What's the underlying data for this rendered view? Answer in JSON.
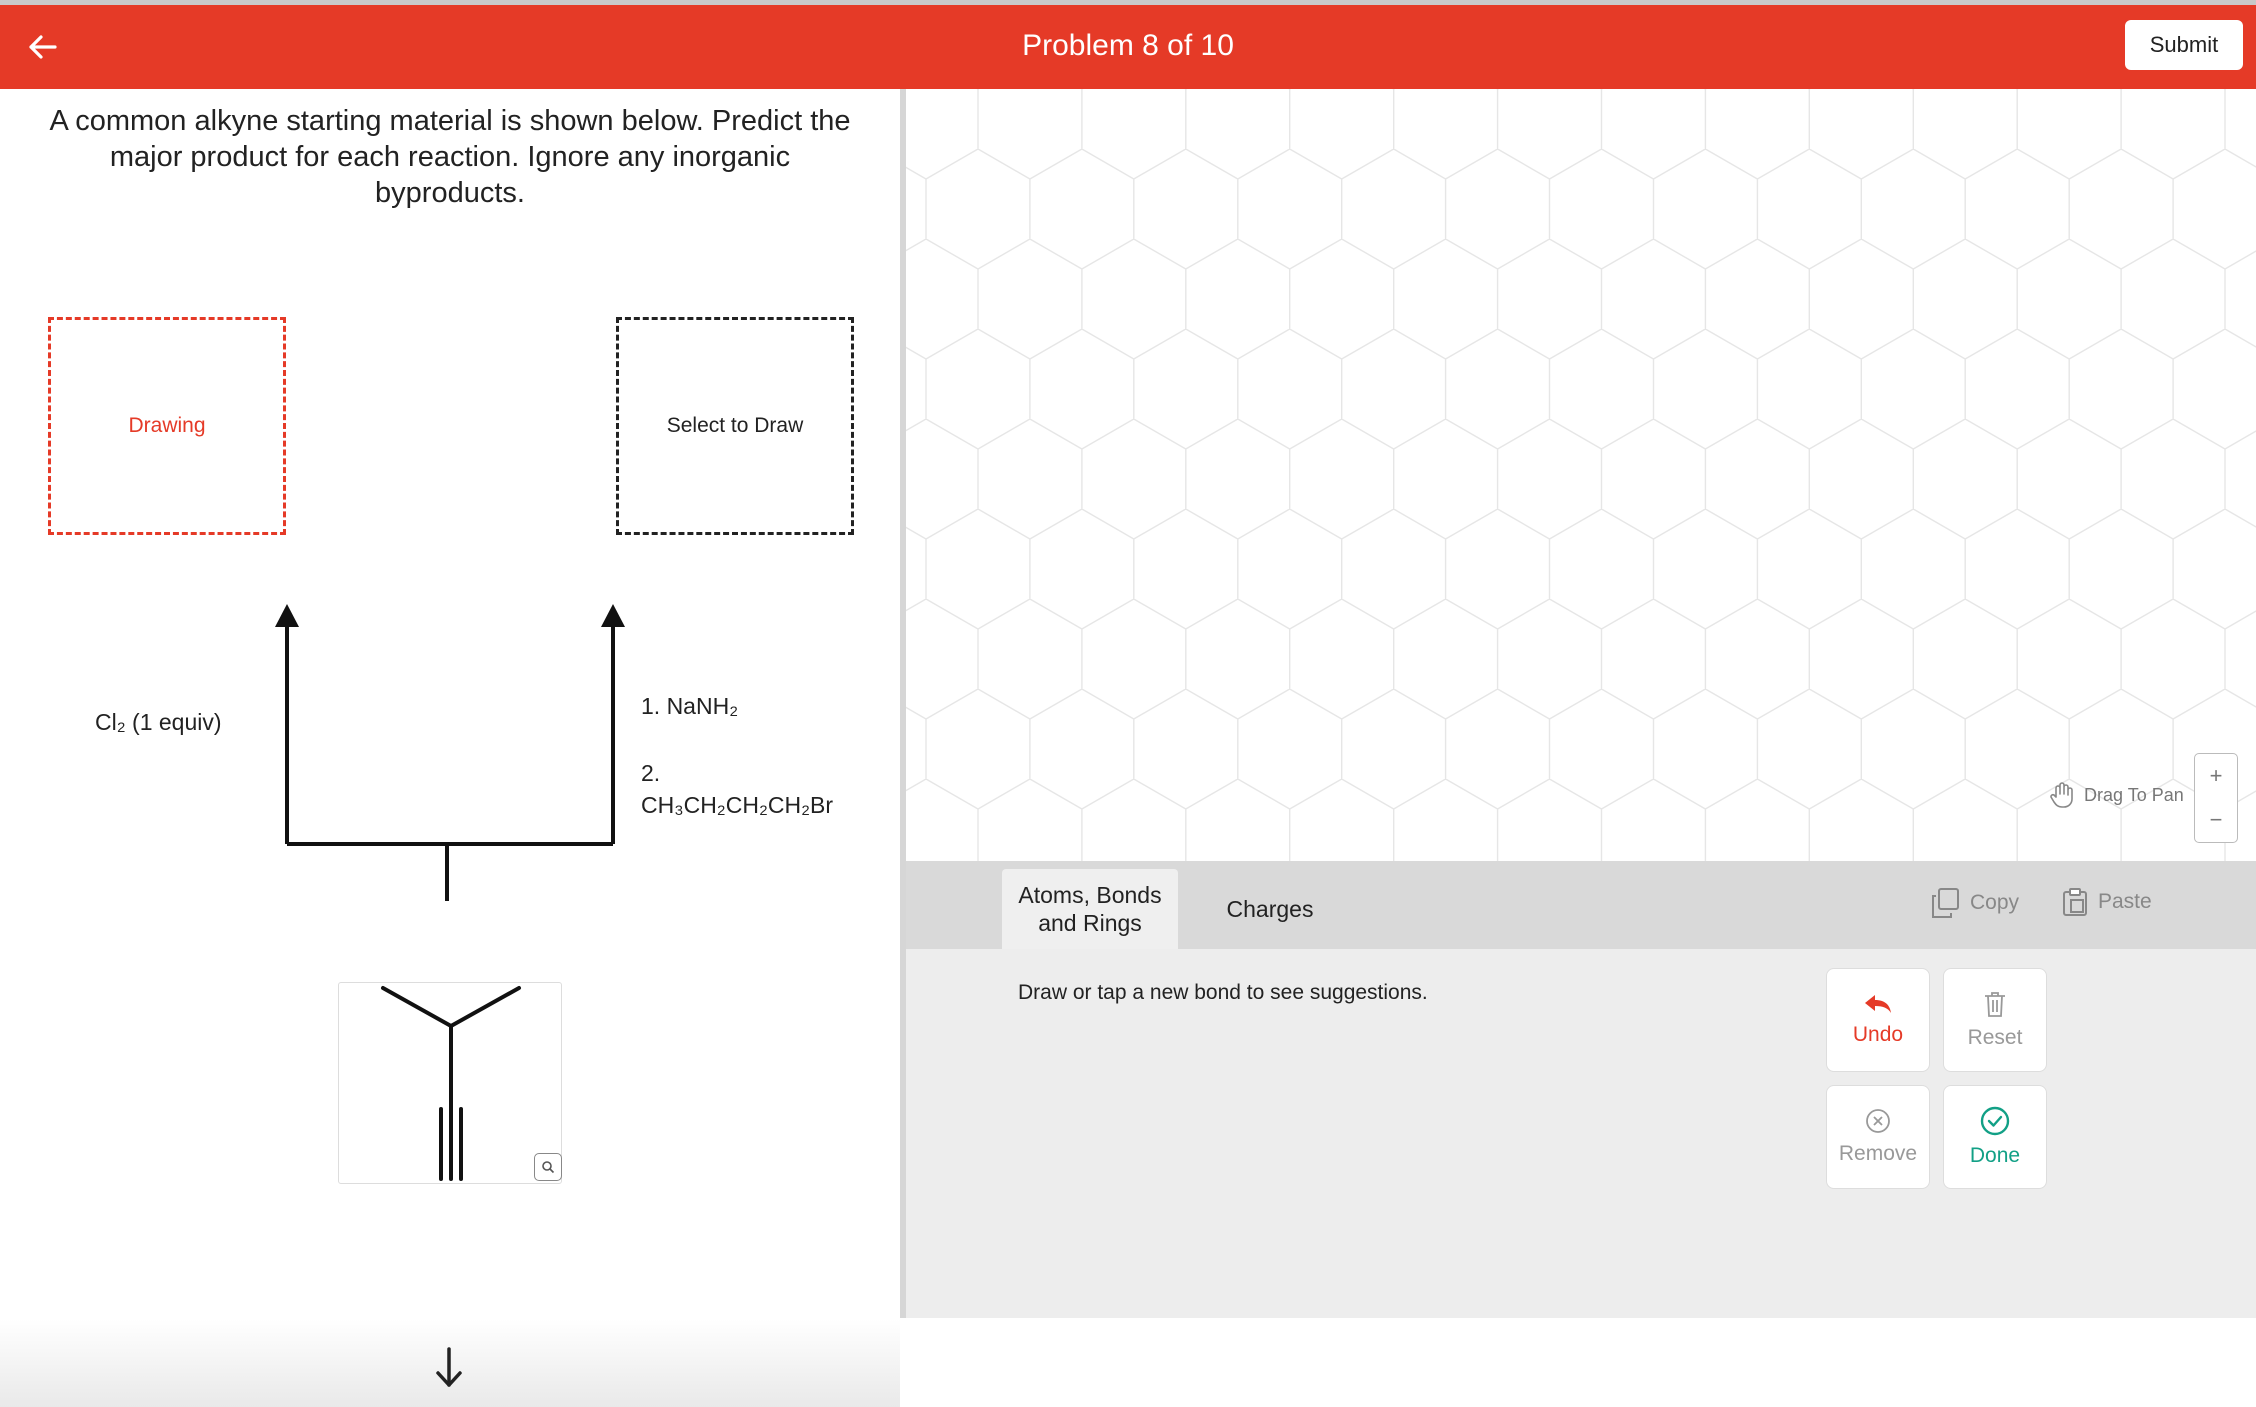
{
  "header": {
    "title": "Problem 8 of 10",
    "submit_label": "Submit"
  },
  "question": {
    "prompt": "A common alkyne starting material is shown below. Predict the major product for each reaction. Ignore any inorganic byproducts.",
    "box_left_label": "Drawing",
    "box_right_label": "Select to Draw",
    "reagent_left": "Cl₂ (1 equiv)",
    "reagent_right_1": "1. NaNH₂",
    "reagent_right_2a": "2.",
    "reagent_right_2b": "CH₃CH₂CH₂CH₂Br"
  },
  "canvas": {
    "drag_label": "Drag To Pan",
    "zoom_in": "+",
    "zoom_out": "−"
  },
  "tabs": [
    {
      "label": "Atoms, Bonds and Rings"
    },
    {
      "label": "Charges"
    }
  ],
  "tools": {
    "copy": "Copy",
    "paste": "Paste"
  },
  "panel": {
    "hint": "Draw or tap a new bond to see suggestions.",
    "undo": "Undo",
    "reset": "Reset",
    "remove": "Remove",
    "done": "Done"
  },
  "colors": {
    "accent": "#e53a27",
    "success": "#12a086"
  }
}
